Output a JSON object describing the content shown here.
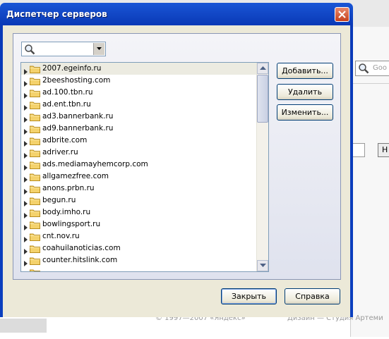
{
  "background": {
    "search_placeholder": "Goo",
    "button_label": "Н",
    "footer_left": "© 1997—2007 «Яндекс»",
    "footer_right": "Дизайн — Студия Артеми"
  },
  "dialog": {
    "title": "Диспетчер серверов",
    "search_value": "",
    "buttons": {
      "add": "Добавить...",
      "remove": "Удалить",
      "edit": "Изменить...",
      "close": "Закрыть",
      "help": "Справка"
    },
    "servers": [
      "2007.egeinfo.ru",
      "2beeshosting.com",
      "ad.100.tbn.ru",
      "ad.ent.tbn.ru",
      "ad3.bannerbank.ru",
      "ad9.bannerbank.ru",
      "adbrite.com",
      "adriver.ru",
      "ads.mediamayhemcorp.com",
      "allgamezfree.com",
      "anons.prbn.ru",
      "begun.ru",
      "body.imho.ru",
      "bowlingsport.ru",
      "cnt.nov.ru",
      "coahuilanoticias.com",
      "counter.hitslink.com",
      ""
    ],
    "selected_index": 0
  },
  "colors": {
    "titlebar": "#0b3fbf",
    "selection": "#ecebe1",
    "folder": "#f4d26c"
  }
}
